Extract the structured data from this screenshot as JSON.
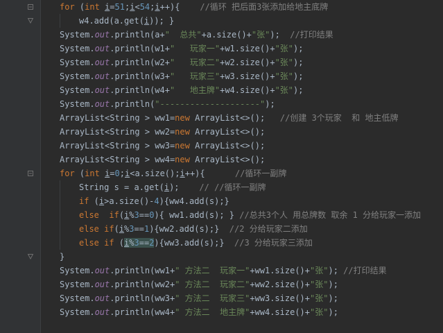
{
  "editor": {
    "lines": [
      [
        {
          "t": "for",
          "c": "kw"
        },
        {
          "t": " (",
          "c": "pn"
        },
        {
          "t": "int",
          "c": "kw"
        },
        {
          "t": " ",
          "c": "pn"
        },
        {
          "t": "i",
          "c": "var"
        },
        {
          "t": "=",
          "c": "pn"
        },
        {
          "t": "51",
          "c": "num"
        },
        {
          "t": ";",
          "c": "pn"
        },
        {
          "t": "i",
          "c": "var"
        },
        {
          "t": "<",
          "c": "pn"
        },
        {
          "t": "54",
          "c": "num"
        },
        {
          "t": ";",
          "c": "pn"
        },
        {
          "t": "i",
          "c": "var"
        },
        {
          "t": "++){    ",
          "c": "pn"
        },
        {
          "t": "//循环 把后面3张添加给地主底牌",
          "c": "cm"
        }
      ],
      [
        {
          "t": "w4.add(a.get(",
          "c": "pn"
        },
        {
          "t": "i",
          "c": "var"
        },
        {
          "t": ")); }",
          "c": "pn"
        }
      ],
      [
        {
          "t": "System.",
          "c": "pn"
        },
        {
          "t": "out",
          "c": "fld"
        },
        {
          "t": ".println(a+",
          "c": "pn"
        },
        {
          "t": "\"  总共\"",
          "c": "str"
        },
        {
          "t": "+a.size()+",
          "c": "pn"
        },
        {
          "t": "\"张\"",
          "c": "str"
        },
        {
          "t": ");  ",
          "c": "pn"
        },
        {
          "t": "//打印结果",
          "c": "cm"
        }
      ],
      [
        {
          "t": "System.",
          "c": "pn"
        },
        {
          "t": "out",
          "c": "fld"
        },
        {
          "t": ".println(w1+",
          "c": "pn"
        },
        {
          "t": "\"   玩家一\"",
          "c": "str"
        },
        {
          "t": "+w1.size()+",
          "c": "pn"
        },
        {
          "t": "\"张\"",
          "c": "str"
        },
        {
          "t": ");",
          "c": "pn"
        }
      ],
      [
        {
          "t": "System.",
          "c": "pn"
        },
        {
          "t": "out",
          "c": "fld"
        },
        {
          "t": ".println(w2+",
          "c": "pn"
        },
        {
          "t": "\"   玩家二\"",
          "c": "str"
        },
        {
          "t": "+w2.size()+",
          "c": "pn"
        },
        {
          "t": "\"张\"",
          "c": "str"
        },
        {
          "t": ");",
          "c": "pn"
        }
      ],
      [
        {
          "t": "System.",
          "c": "pn"
        },
        {
          "t": "out",
          "c": "fld"
        },
        {
          "t": ".println(w3+",
          "c": "pn"
        },
        {
          "t": "\"   玩家三\"",
          "c": "str"
        },
        {
          "t": "+w3.size()+",
          "c": "pn"
        },
        {
          "t": "\"张\"",
          "c": "str"
        },
        {
          "t": ");",
          "c": "pn"
        }
      ],
      [
        {
          "t": "System.",
          "c": "pn"
        },
        {
          "t": "out",
          "c": "fld"
        },
        {
          "t": ".println(w4+",
          "c": "pn"
        },
        {
          "t": "\"   地主牌\"",
          "c": "str"
        },
        {
          "t": "+w4.size()+",
          "c": "pn"
        },
        {
          "t": "\"张\"",
          "c": "str"
        },
        {
          "t": ");",
          "c": "pn"
        }
      ],
      [
        {
          "t": "System.",
          "c": "pn"
        },
        {
          "t": "out",
          "c": "fld"
        },
        {
          "t": ".println(",
          "c": "pn"
        },
        {
          "t": "\"--------------------\"",
          "c": "str"
        },
        {
          "t": ");",
          "c": "pn"
        }
      ],
      [
        {
          "t": "ArrayList<String > ww1=",
          "c": "pn"
        },
        {
          "t": "new",
          "c": "kw"
        },
        {
          "t": " ArrayList<>();   ",
          "c": "pn"
        },
        {
          "t": "//创建 3个玩家  和 地主低牌",
          "c": "cm"
        }
      ],
      [
        {
          "t": "ArrayList<String > ww2=",
          "c": "pn"
        },
        {
          "t": "new",
          "c": "kw"
        },
        {
          "t": " ArrayList<>();",
          "c": "pn"
        }
      ],
      [
        {
          "t": "ArrayList<String > ww3=",
          "c": "pn"
        },
        {
          "t": "new",
          "c": "kw"
        },
        {
          "t": " ArrayList<>();",
          "c": "pn"
        }
      ],
      [
        {
          "t": "ArrayList<String > ww4=",
          "c": "pn"
        },
        {
          "t": "new",
          "c": "kw"
        },
        {
          "t": " ArrayList<>();",
          "c": "pn"
        }
      ],
      [
        {
          "t": "for",
          "c": "kw"
        },
        {
          "t": " (",
          "c": "pn"
        },
        {
          "t": "int",
          "c": "kw"
        },
        {
          "t": " ",
          "c": "pn"
        },
        {
          "t": "i",
          "c": "var"
        },
        {
          "t": "=",
          "c": "pn"
        },
        {
          "t": "0",
          "c": "num"
        },
        {
          "t": ";",
          "c": "pn"
        },
        {
          "t": "i",
          "c": "var"
        },
        {
          "t": "<a.size();",
          "c": "pn"
        },
        {
          "t": "i",
          "c": "var"
        },
        {
          "t": "++){      ",
          "c": "pn"
        },
        {
          "t": "//循环一副牌",
          "c": "cm"
        }
      ],
      [
        {
          "t": "String s = a.get(",
          "c": "pn"
        },
        {
          "t": "i",
          "c": "var"
        },
        {
          "t": ");    ",
          "c": "pn"
        },
        {
          "t": "// //循环一副牌",
          "c": "cm"
        }
      ],
      [
        {
          "t": "if",
          "c": "kw"
        },
        {
          "t": " (",
          "c": "pn"
        },
        {
          "t": "i",
          "c": "var"
        },
        {
          "t": ">a.size()-",
          "c": "pn"
        },
        {
          "t": "4",
          "c": "num"
        },
        {
          "t": "){ww4.add(s);}",
          "c": "pn"
        }
      ],
      [
        {
          "t": "else",
          "c": "kw"
        },
        {
          "t": "  ",
          "c": "pn"
        },
        {
          "t": "if",
          "c": "kw"
        },
        {
          "t": "(",
          "c": "pn"
        },
        {
          "t": "i",
          "c": "var"
        },
        {
          "t": "%",
          "c": "pn"
        },
        {
          "t": "3",
          "c": "num"
        },
        {
          "t": "==",
          "c": "pn"
        },
        {
          "t": "0",
          "c": "num"
        },
        {
          "t": "){ ww1.add(s); } ",
          "c": "pn"
        },
        {
          "t": "//总共3个人 用总牌数 取余 1 分给玩家一添加",
          "c": "cm"
        }
      ],
      [
        {
          "t": "else if",
          "c": "kw"
        },
        {
          "t": "(",
          "c": "pn"
        },
        {
          "t": "i",
          "c": "var"
        },
        {
          "t": "%",
          "c": "pn"
        },
        {
          "t": "3",
          "c": "num"
        },
        {
          "t": "==",
          "c": "pn"
        },
        {
          "t": "1",
          "c": "num"
        },
        {
          "t": "){ww2.add(s);}  ",
          "c": "pn"
        },
        {
          "t": "//2 分给玩家二添加",
          "c": "cm"
        }
      ],
      [
        {
          "t": "else if",
          "c": "kw"
        },
        {
          "t": " (",
          "c": "pn"
        },
        {
          "t": "i",
          "c": "var hl"
        },
        {
          "t": "%",
          "c": "pn hl"
        },
        {
          "t": "3",
          "c": "num hl"
        },
        {
          "t": "==",
          "c": "pn hl"
        },
        {
          "t": "2",
          "c": "num hl"
        },
        {
          "t": "){ww3.add(s);}  ",
          "c": "pn"
        },
        {
          "t": "//3 分给玩家三添加",
          "c": "cm"
        }
      ],
      [
        {
          "t": "}",
          "c": "pn"
        }
      ],
      [
        {
          "t": "System.",
          "c": "pn"
        },
        {
          "t": "out",
          "c": "fld"
        },
        {
          "t": ".println(ww1+",
          "c": "pn"
        },
        {
          "t": "\" 方法二  玩家一\"",
          "c": "str"
        },
        {
          "t": "+ww1.size()+",
          "c": "pn"
        },
        {
          "t": "\"张\"",
          "c": "str"
        },
        {
          "t": "); ",
          "c": "pn"
        },
        {
          "t": "//打印结果",
          "c": "cm"
        }
      ],
      [
        {
          "t": "System.",
          "c": "pn"
        },
        {
          "t": "out",
          "c": "fld"
        },
        {
          "t": ".println(ww2+",
          "c": "pn"
        },
        {
          "t": "\" 方法二  玩家二\"",
          "c": "str"
        },
        {
          "t": "+ww2.size()+",
          "c": "pn"
        },
        {
          "t": "\"张\"",
          "c": "str"
        },
        {
          "t": ");",
          "c": "pn"
        }
      ],
      [
        {
          "t": "System.",
          "c": "pn"
        },
        {
          "t": "out",
          "c": "fld"
        },
        {
          "t": ".println(ww3+",
          "c": "pn"
        },
        {
          "t": "\" 方法二  玩家三\"",
          "c": "str"
        },
        {
          "t": "+ww3.size()+",
          "c": "pn"
        },
        {
          "t": "\"张\"",
          "c": "str"
        },
        {
          "t": ");",
          "c": "pn"
        }
      ],
      [
        {
          "t": "System.",
          "c": "pn"
        },
        {
          "t": "out",
          "c": "fld"
        },
        {
          "t": ".println(ww4+",
          "c": "pn"
        },
        {
          "t": "\" 方法二  地主牌\"",
          "c": "str"
        },
        {
          "t": "+ww4.size()+",
          "c": "pn"
        },
        {
          "t": "\"张\"",
          "c": "str"
        },
        {
          "t": ");",
          "c": "pn"
        }
      ]
    ],
    "colors": {
      "background": "#2b2b2b",
      "gutter": "#313335",
      "keyword": "#cc7832",
      "string": "#6a8759",
      "comment": "#808080",
      "number": "#6897bb",
      "static_field": "#9876aa",
      "default_text": "#a9b7c6",
      "occurrence_highlight": "#3b514d"
    }
  }
}
